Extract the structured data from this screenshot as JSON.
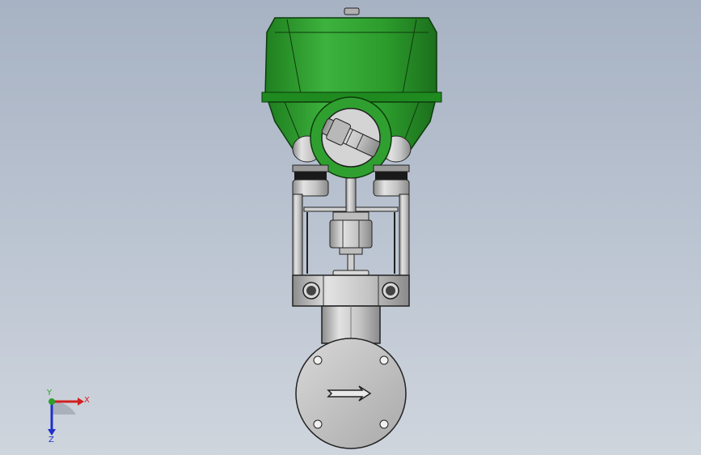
{
  "viewport": {
    "background_top": "#a7b2c3",
    "background_bottom": "#cfd5dd"
  },
  "model": {
    "actuator_color": "#2f9a2f",
    "metal_color": "#c8c8c8",
    "flow_arrow_icon": "flow-direction-arrow"
  },
  "triad": {
    "x_label": "X",
    "y_label": "Y",
    "z_label": "Z",
    "x_color": "#d22020",
    "y_color": "#2aa02a",
    "z_color": "#2030c8"
  }
}
